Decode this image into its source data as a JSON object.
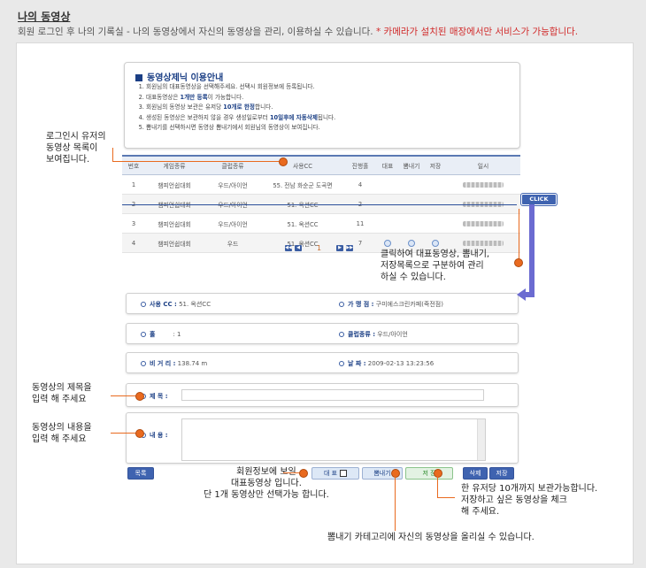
{
  "header": {
    "title": "나의 동영상",
    "subtitle": "회원 로그인 후 나의 기록실 - 나의 동영상에서 자신의 동영상을 관리, 이용하실 수 있습니다.",
    "warning": "* 카메라가 설치된 매장에서만 서비스가 가능합니다."
  },
  "guide": {
    "title": "동영상제닉 이용안내",
    "items": [
      {
        "pre": "회원님의 대표동영상을 선택해주세요. 선택시 회원정보에 등록됩니다.",
        "hl": "",
        "post": ""
      },
      {
        "pre": "대표동영상은 ",
        "hl": "1개만 등록",
        "post": "이 가능합니다."
      },
      {
        "pre": "회원님의 동영상 보관은 유저당 ",
        "hl": "10개로 한정",
        "post": "합니다."
      },
      {
        "pre": "생성된 동영상은 보관하지 않을 경우 생성일로부터 ",
        "hl": "10일후에 자동삭제",
        "post": "됩니다."
      },
      {
        "pre": "뽐내기를 선택하시면 동영상 뽐내기에서 회원님의 동영상이 보여집니다.",
        "hl": "",
        "post": ""
      }
    ]
  },
  "table": {
    "headers": [
      "번호",
      "게임종류",
      "클럽종류",
      "사용CC",
      "진행홀",
      "대표",
      "뽐내기",
      "저장",
      "일시"
    ],
    "rows": [
      {
        "no": "1",
        "game": "챔피언쉽대회",
        "club": "우드/아이언",
        "cc": "55. 전남 화순군 도곡면",
        "hole": "4",
        "rep": false,
        "show": false,
        "save": false
      },
      {
        "no": "2",
        "game": "챔피언쉽대회",
        "club": "우드/아이언",
        "cc": "51. 옥션CC",
        "hole": "2",
        "rep": false,
        "show": false,
        "save": false
      },
      {
        "no": "3",
        "game": "챔피언쉽대회",
        "club": "우드/아이언",
        "cc": "51. 옥션CC",
        "hole": "11",
        "rep": false,
        "show": false,
        "save": false
      },
      {
        "no": "4",
        "game": "챔피언쉽대회",
        "club": "우드",
        "cc": "51. 옥션CC",
        "hole": "7",
        "rep": true,
        "show": true,
        "save": true
      }
    ]
  },
  "pager": {
    "current": "1"
  },
  "detail": {
    "cc_label": "사용 CC :",
    "cc_value": "51. 옥션CC",
    "store_label": "가 맹 점 :",
    "store_value": "구미에스크린카페(죽전점)",
    "hole_label": "홀",
    "hole_value": ": 1",
    "club_label": "클럽종류 :",
    "club_value": "우드/아이언",
    "dist_label": "비 거 리 :",
    "dist_value": "138.74 m",
    "date_label": "날     짜 :",
    "date_value": "2009-02-13 13:23:56",
    "title_label": "제     목 :",
    "content_label": "내     용 :"
  },
  "buttons": {
    "list": "목록",
    "representative": "대 표",
    "show_off": "뽐내기",
    "save": "저 장",
    "delete": "삭제",
    "store": "저장"
  },
  "annotations": {
    "list_note": [
      "로그인시 유저의",
      "동영상 목록이",
      "보여집니다."
    ],
    "click": "CLICK",
    "click_note": [
      "클릭하여 대표동영상, 뽐내기,",
      "저장목록으로 구분하여 관리",
      "하실 수 있습니다."
    ],
    "title_note": [
      "동영상의 제목을",
      "입력 해 주세요"
    ],
    "content_note": [
      "동영상의 내용을",
      "입력 해 주세요"
    ],
    "rep_note": [
      "회원정보에 보일",
      "대표동영상 입니다.",
      "단 1개 동영상만 선택가능 합니다."
    ],
    "save_note": [
      "한 유저당 10개까지 보관가능합니다.",
      "저장하고 싶은 동영상을 체크",
      "해 주세요."
    ],
    "show_note": "뽐내기 카테고리에 자신의 동영상을 올리실 수 있습니다."
  }
}
